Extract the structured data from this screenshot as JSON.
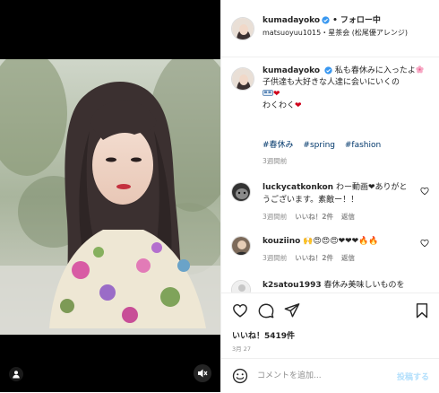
{
  "media": {
    "tag_icon": "person-tag-icon",
    "mute_icon": "speaker-muted-icon"
  },
  "header": {
    "username": "kumadayoko",
    "separator": "•",
    "follow_label": "フォロー中",
    "location": "matsuoyuu1015・星茶会 (松尾優アレンジ)"
  },
  "caption": {
    "username": "kumadayoko",
    "line1": "私も春休みに入ったよ",
    "line2": "子供達も大好きな人達に会いにいくの",
    "line3": "わくわく",
    "heart": "❤",
    "hashtags": [
      "#春休み",
      "#spring",
      "#fashion"
    ],
    "time": "3週間前"
  },
  "comments": [
    {
      "username": "luckycatkonkon",
      "text": "わー動画❤ありがとうございます。素敵ー！！",
      "time": "3週間前",
      "likes": "いいね！2件",
      "reply": "返信"
    },
    {
      "username": "kouziino",
      "text": "🙌😍😍😍❤❤❤🔥🔥",
      "time": "3週間前",
      "likes": "いいね！2件",
      "reply": "返信"
    },
    {
      "username": "k2satou1993",
      "text": "春休み美味しいものを"
    }
  ],
  "actions": {
    "likes": "いいね！5419件",
    "date": "3月 27"
  },
  "comment_box": {
    "placeholder": "コメントを追加...",
    "post_label": "投稿する"
  },
  "colors": {
    "link": "#00376b",
    "muted": "#8e8e8e",
    "verified": "#3897f0",
    "post_disabled": "#b2dffc"
  }
}
